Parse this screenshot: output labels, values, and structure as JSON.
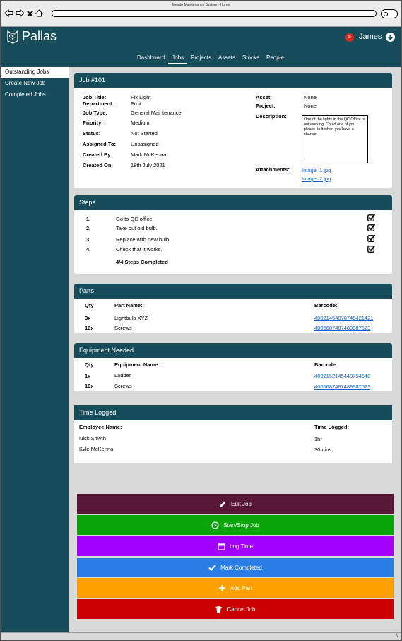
{
  "browser": {
    "window_title": "Meade Maintenance System - Home",
    "back_icon": "back-arrow-icon",
    "forward_icon": "forward-arrow-icon",
    "close_icon": "close-icon",
    "home_icon": "home-icon",
    "search_icon": "search-icon"
  },
  "header": {
    "brand": "Pallas",
    "notification_count": "5",
    "user_name": "James",
    "colors": {
      "primary": "#174d5b",
      "badge": "#e0281c"
    }
  },
  "tabs": [
    {
      "label": "Dashboard",
      "active": false
    },
    {
      "label": "Jobs",
      "active": true
    },
    {
      "label": "Projects",
      "active": false
    },
    {
      "label": "Assets",
      "active": false
    },
    {
      "label": "Stocks",
      "active": false
    },
    {
      "label": "People",
      "active": false
    }
  ],
  "sidebar": {
    "items": [
      {
        "label": "Outstanding Jobs",
        "active": true
      },
      {
        "label": "Create New Job",
        "active": false
      },
      {
        "label": "Completed Jobs",
        "active": false
      }
    ]
  },
  "job": {
    "title": "Job #101",
    "fields": {
      "job_title_label": "Job Title:",
      "job_title": "Fix Light",
      "department_label": "Department:",
      "department": "Fruit",
      "job_type_label": "Job Type:",
      "job_type": "General Maintenance",
      "priority_label": "Priority:",
      "priority": "Medium",
      "status_label": "Status:",
      "status": "Not Started",
      "assigned_label": "Assigned To:",
      "assigned": "Unassigned",
      "created_by_label": "Created By:",
      "created_by": "Mark McKenna",
      "created_on_label": "Created On:",
      "created_on": "18th July 2021",
      "asset_label": "Asset:",
      "asset": "None",
      "project_label": "Project:",
      "project": "None",
      "description_label": "Description:",
      "description": "One of the lights in the QC Office is not working. Could one of you please fix it when you have a chance.",
      "attachments_label": "Attachments:",
      "attachments": [
        "Image_1.jpg",
        "Image_2.jpg"
      ]
    }
  },
  "steps": {
    "title": "Steps",
    "items": [
      {
        "num": "1.",
        "text": "Go to QC office",
        "done": true
      },
      {
        "num": "2.",
        "text": "Take out old bulb.",
        "done": true
      },
      {
        "num": "3.",
        "text": "Replace with new bulb",
        "done": true
      },
      {
        "num": "4.",
        "text": "Check that it works.",
        "done": true
      }
    ],
    "summary": "4/4 Steps Completed"
  },
  "parts": {
    "title": "Parts",
    "headers": {
      "qty": "Qty",
      "name": "Part Name:",
      "barcode": "Barcode:"
    },
    "rows": [
      {
        "qty": "3x",
        "name": "Lightbulb XYZ",
        "barcode": "4002145487874542142​1"
      },
      {
        "qty": "10x",
        "name": "Screws",
        "barcode": "4005687487489987523"
      }
    ]
  },
  "equipment": {
    "title": "Equipment Needed",
    "headers": {
      "qty": "Qty",
      "name": "Equipment Name:",
      "barcode": "Barcode:"
    },
    "rows": [
      {
        "qty": "1x",
        "name": "Ladder",
        "barcode": "4002152145448754548"
      },
      {
        "qty": "10x",
        "name": "Screws",
        "barcode": "4005687487489987523"
      }
    ]
  },
  "time": {
    "title": "Time Logged",
    "headers": {
      "employee": "Employee Name:",
      "time": "Time Logged:"
    },
    "rows": [
      {
        "employee": "Nick Smyth",
        "time": "1hr"
      },
      {
        "employee": "Kyle McKenna",
        "time": "30mins"
      }
    ]
  },
  "actions": [
    {
      "label": "Edit Job",
      "icon": "pencil-icon",
      "color": "#561634"
    },
    {
      "label": "Start/Stop Job",
      "icon": "clock-icon",
      "color": "#0aa50a"
    },
    {
      "label": "Log Time",
      "icon": "calendar-icon",
      "color": "#a200ff"
    },
    {
      "label": "Mark Completed",
      "icon": "checkmark-icon",
      "color": "#2b7de6"
    },
    {
      "label": "Add Part",
      "icon": "plus-icon",
      "color": "#ffa000"
    },
    {
      "label": "Cancel Job",
      "icon": "trash-icon",
      "color": "#cc0000"
    }
  ]
}
